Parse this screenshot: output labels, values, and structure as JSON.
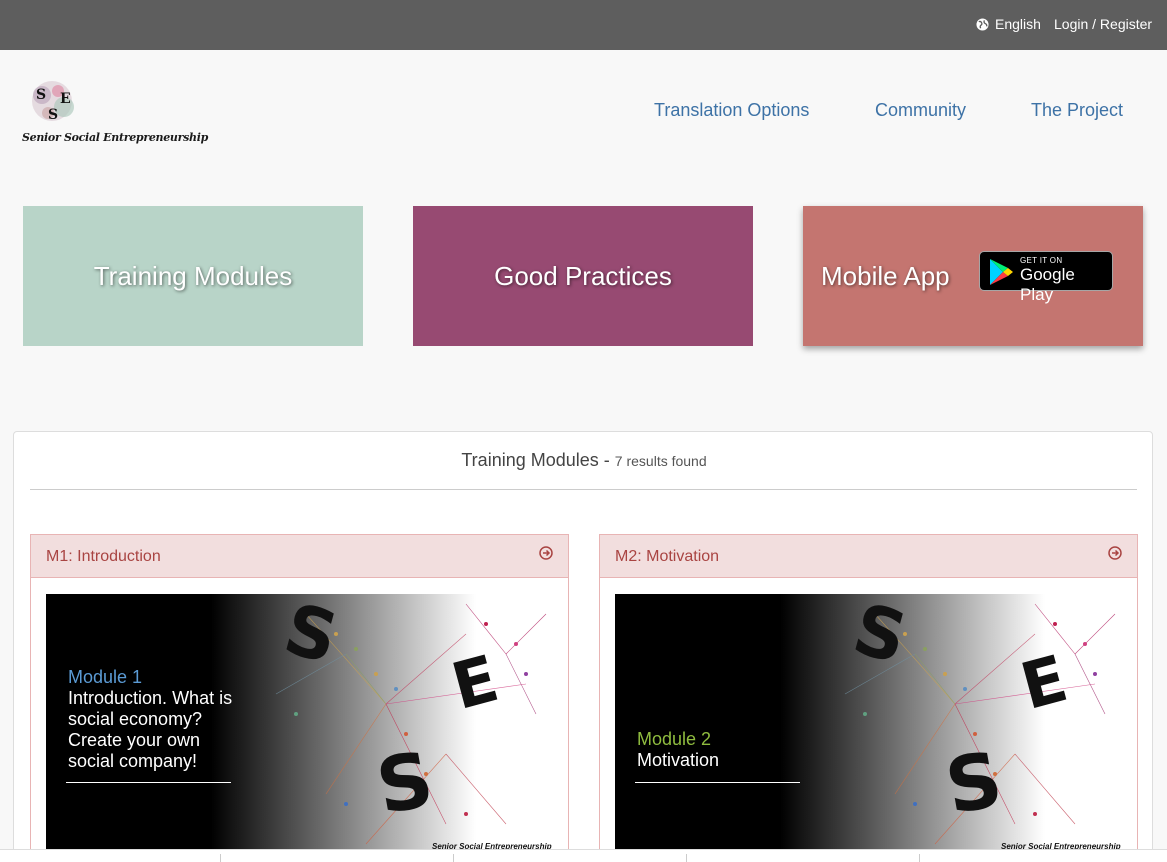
{
  "topbar": {
    "language": "English",
    "login": "Login / Register"
  },
  "logo": {
    "text": "Senior Social Entrepreneurship",
    "letters": [
      "S",
      "E",
      "S"
    ]
  },
  "nav": {
    "items": [
      "Translation Options",
      "Community",
      "The Project"
    ]
  },
  "tiles": {
    "training": "Training Modules",
    "practices": "Good Practices",
    "mobile": "Mobile App",
    "gplay_small": "GET IT ON",
    "gplay_big": "Google Play"
  },
  "panel": {
    "title": "Training Modules",
    "separator": "-",
    "count": "7 results found"
  },
  "cards": [
    {
      "title": "M1: Introduction",
      "module_label": "Module 1",
      "module_text": "Introduction. What is social economy? Create your own social company!",
      "brand": "Senior Social Entrepreneurship"
    },
    {
      "title": "M2: Motivation",
      "module_label": "Module 2",
      "module_text": "Motivation",
      "brand": "Senior Social Entrepreneurship"
    }
  ],
  "colors": {
    "topbar": "#5e5e5e",
    "nav_link": "#3d72a6",
    "tile_training": "#b8d4c8",
    "tile_practices": "#974a72",
    "tile_mobile": "#c47570",
    "card_header": "#f2dede",
    "card_title": "#a94442",
    "module1_label": "#5b9bd5",
    "module2_label": "#8fbc3f"
  },
  "icons": {
    "language": "globe-icon",
    "card_link": "circle-arrow-right-icon",
    "store": "google-play-icon"
  }
}
